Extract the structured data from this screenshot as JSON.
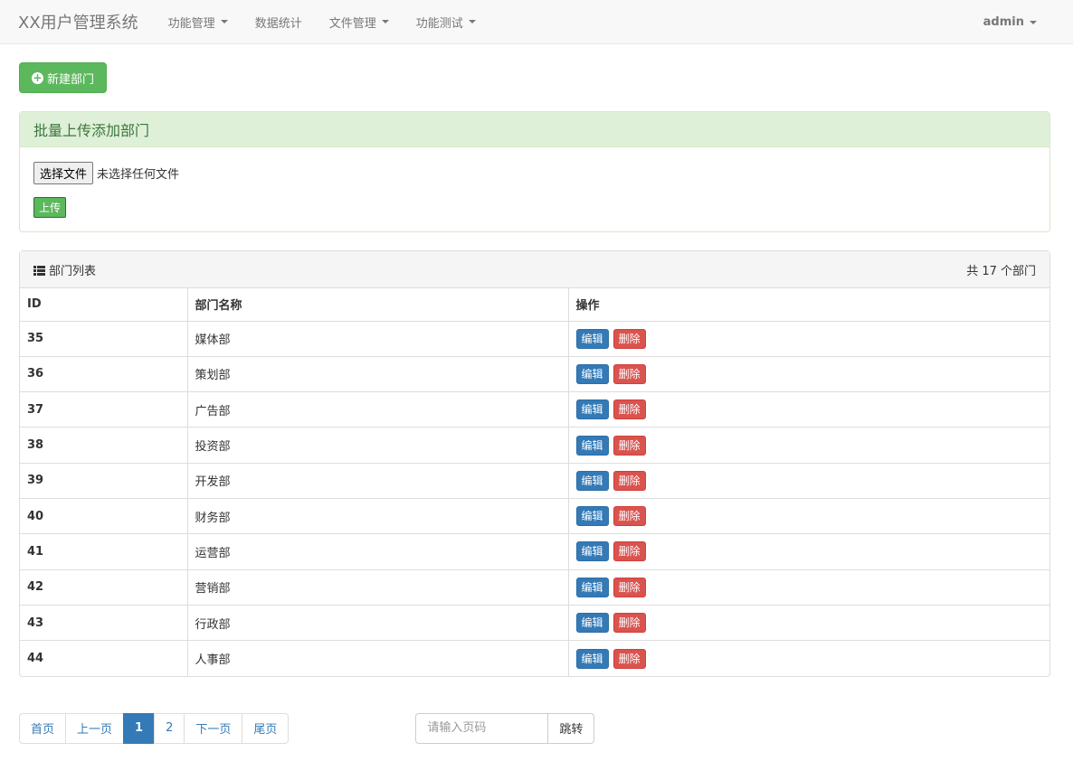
{
  "navbar": {
    "brand": "XX用户管理系统",
    "items": [
      {
        "label": "功能管理",
        "dropdown": true
      },
      {
        "label": "数据统计",
        "dropdown": false
      },
      {
        "label": "文件管理",
        "dropdown": true
      },
      {
        "label": "功能测试",
        "dropdown": true
      }
    ],
    "user": "admin"
  },
  "new_button": "新建部门",
  "upload_panel": {
    "title": "批量上传添加部门",
    "choose_file": "选择文件",
    "no_file": "未选择任何文件",
    "upload": "上传"
  },
  "list_panel": {
    "title": "部门列表",
    "total": "共 17 个部门",
    "headers": {
      "id": "ID",
      "name": "部门名称",
      "ops": "操作"
    },
    "edit_label": "编辑",
    "delete_label": "删除",
    "rows": [
      {
        "id": "35",
        "name": "媒体部"
      },
      {
        "id": "36",
        "name": "策划部"
      },
      {
        "id": "37",
        "name": "广告部"
      },
      {
        "id": "38",
        "name": "投资部"
      },
      {
        "id": "39",
        "name": "开发部"
      },
      {
        "id": "40",
        "name": "财务部"
      },
      {
        "id": "41",
        "name": "运营部"
      },
      {
        "id": "42",
        "name": "营销部"
      },
      {
        "id": "43",
        "name": "行政部"
      },
      {
        "id": "44",
        "name": "人事部"
      }
    ]
  },
  "pagination": {
    "first": "首页",
    "prev": "上一页",
    "pages": [
      "1",
      "2"
    ],
    "current": "1",
    "next": "下一页",
    "last": "尾页"
  },
  "jump": {
    "placeholder": "请输入页码",
    "button": "跳转"
  }
}
